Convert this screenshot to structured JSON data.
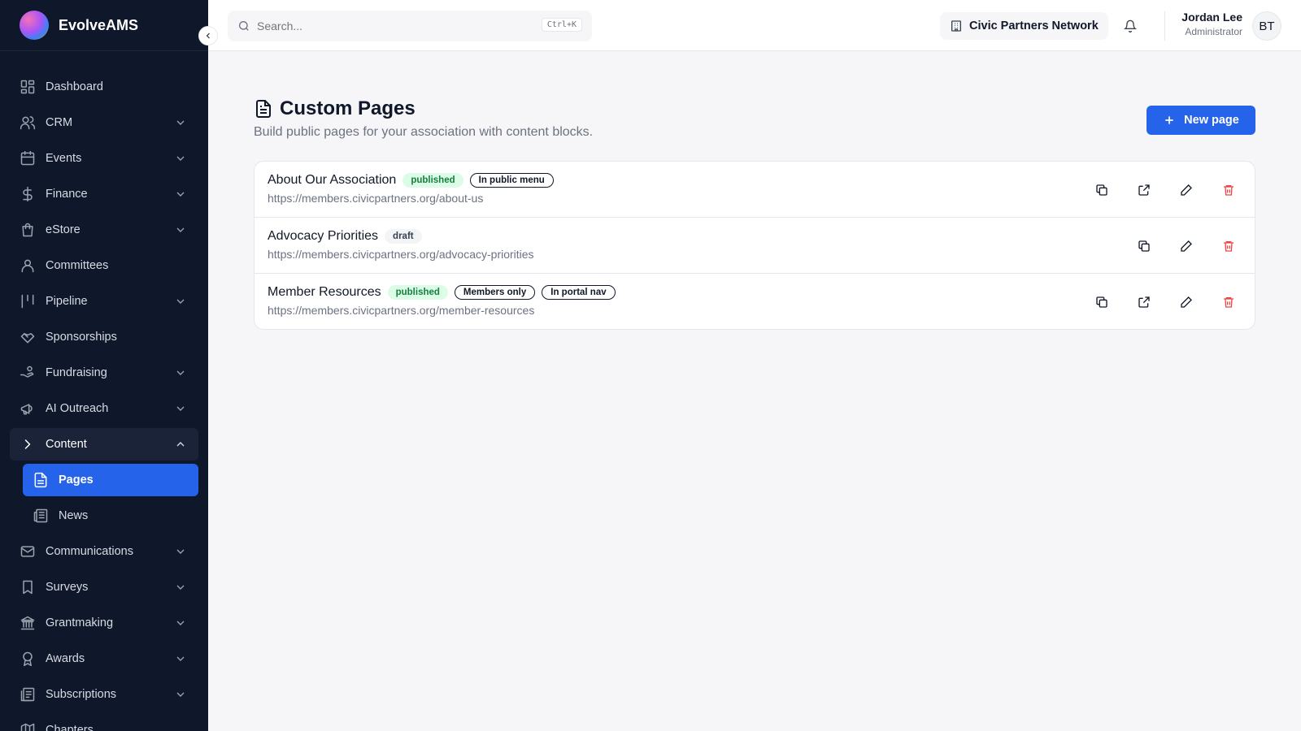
{
  "app": {
    "name": "EvolveAMS"
  },
  "sidebar": {
    "items": [
      {
        "label": "Dashboard",
        "icon": "dashboard-icon",
        "expandable": false
      },
      {
        "label": "CRM",
        "icon": "users-icon",
        "expandable": true
      },
      {
        "label": "Events",
        "icon": "calendar-icon",
        "expandable": true
      },
      {
        "label": "Finance",
        "icon": "dollar-icon",
        "expandable": true
      },
      {
        "label": "eStore",
        "icon": "shopping-bag-icon",
        "expandable": true
      },
      {
        "label": "Committees",
        "icon": "user-icon",
        "expandable": false
      },
      {
        "label": "Pipeline",
        "icon": "pipeline-icon",
        "expandable": true
      },
      {
        "label": "Sponsorships",
        "icon": "handshake-icon",
        "expandable": false
      },
      {
        "label": "Fundraising",
        "icon": "hand-coins-icon",
        "expandable": true
      },
      {
        "label": "AI Outreach",
        "icon": "megaphone-icon",
        "expandable": true
      },
      {
        "label": "Content",
        "icon": "chevron-right-icon",
        "expandable": true,
        "open": true,
        "children": [
          {
            "label": "Pages",
            "icon": "file-text-icon",
            "active": true
          },
          {
            "label": "News",
            "icon": "newspaper-icon",
            "active": false
          }
        ]
      },
      {
        "label": "Communications",
        "icon": "mail-icon",
        "expandable": true
      },
      {
        "label": "Surveys",
        "icon": "bookmark-icon",
        "expandable": true
      },
      {
        "label": "Grantmaking",
        "icon": "landmark-icon",
        "expandable": true
      },
      {
        "label": "Awards",
        "icon": "award-icon",
        "expandable": true
      },
      {
        "label": "Subscriptions",
        "icon": "subscriptions-icon",
        "expandable": true
      },
      {
        "label": "Chapters",
        "icon": "map-icon",
        "expandable": false
      }
    ]
  },
  "header": {
    "search": {
      "placeholder": "Search...",
      "shortcut": "Ctrl+K"
    },
    "org": "Civic Partners Network",
    "user": {
      "name": "Jordan Lee",
      "role": "Administrator",
      "initials": "BT"
    }
  },
  "main": {
    "title": "Custom Pages",
    "subtitle": "Build public pages for your association with content blocks.",
    "new_button": "New page",
    "pages": [
      {
        "title": "About Our Association",
        "status": "published",
        "tags": [
          "In public menu"
        ],
        "url": "https://members.civicpartners.org/about-us",
        "has_open": true
      },
      {
        "title": "Advocacy Priorities",
        "status": "draft",
        "tags": [],
        "url": "https://members.civicpartners.org/advocacy-priorities",
        "has_open": false
      },
      {
        "title": "Member Resources",
        "status": "published",
        "tags": [
          "Members only",
          "In portal nav"
        ],
        "url": "https://members.civicpartners.org/member-resources",
        "has_open": true
      }
    ]
  },
  "colors": {
    "sidebar_bg": "#0f172a",
    "accent": "#2563eb",
    "published_bg": "#dcfce7",
    "published_fg": "#15803d",
    "danger": "#ef4444"
  }
}
